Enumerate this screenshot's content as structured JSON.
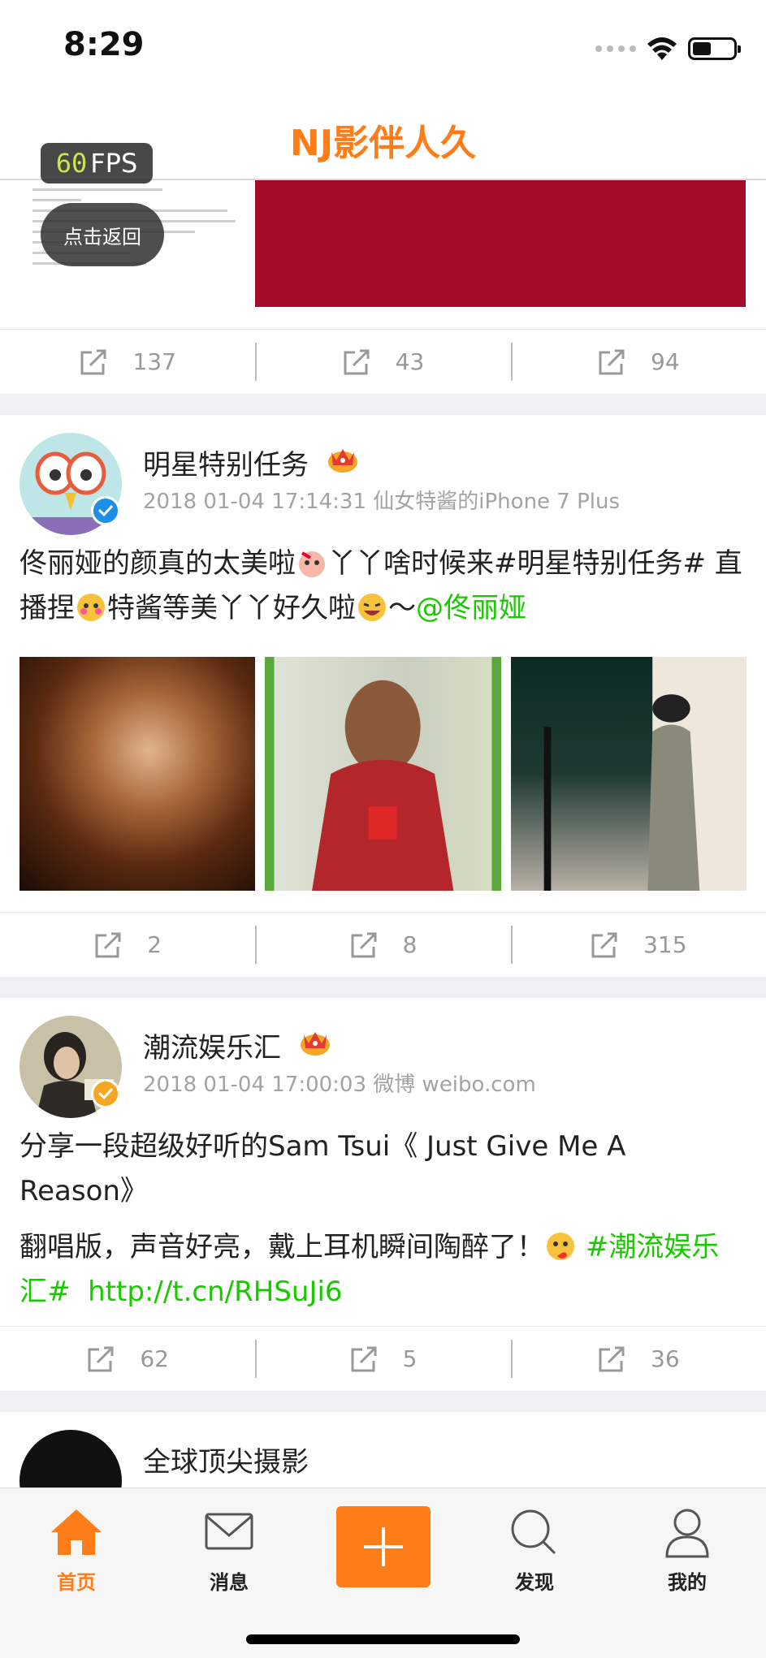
{
  "status_bar": {
    "time": "8:29",
    "battery_level": 0.45
  },
  "nav": {
    "title": "NJ影伴人久"
  },
  "overlay": {
    "fps_value": "60",
    "fps_unit": "FPS",
    "back_label": "点击返回"
  },
  "colors": {
    "brand": "#ff7d18",
    "link": "#19c900",
    "verified_blue": "#1d8fe8",
    "verified_gold": "#f5a623",
    "inactive_icon": "#555555"
  },
  "top_post": {
    "actions": [
      {
        "icon": "share-icon",
        "count": "137"
      },
      {
        "icon": "share-icon",
        "count": "43"
      },
      {
        "icon": "share-icon",
        "count": "94"
      }
    ]
  },
  "posts": [
    {
      "username": "明星特别任务",
      "badge": "crown-icon",
      "verified": "blue",
      "meta": "2018 01-04 17:14:31 仙女特酱的iPhone 7 Plus",
      "text_parts": [
        "佟丽娅的颜真的太美啦",
        "丫丫啥时候来#明星特别任务# 直播捏",
        "特酱等美丫丫好久啦",
        "～",
        "@佟丽娅"
      ],
      "actions": [
        {
          "icon": "share-icon",
          "count": "2"
        },
        {
          "icon": "share-icon",
          "count": "8"
        },
        {
          "icon": "share-icon",
          "count": "315"
        }
      ]
    },
    {
      "username": "潮流娱乐汇",
      "badge": "crown-icon",
      "verified": "gold",
      "meta": "2018 01-04 17:00:03 微博 weibo.com",
      "text_parts": [
        "分享一段超级好听的Sam Tsui《 Just Give Me A Reason》",
        "翻唱版，声音好亮，戴上耳机瞬间陶醉了！",
        "#潮流娱乐汇#",
        "http://t.cn/RHSuJi6"
      ],
      "actions": [
        {
          "icon": "share-icon",
          "count": "62"
        },
        {
          "icon": "share-icon",
          "count": "5"
        },
        {
          "icon": "share-icon",
          "count": "36"
        }
      ]
    },
    {
      "username": "全球顶尖摄影"
    }
  ],
  "tab_bar": {
    "tabs": [
      {
        "label": "首页",
        "icon": "home-icon",
        "active": true
      },
      {
        "label": "消息",
        "icon": "mail-icon",
        "active": false
      },
      {
        "label": "",
        "icon": "plus-icon",
        "active": false
      },
      {
        "label": "发现",
        "icon": "search-icon",
        "active": false
      },
      {
        "label": "我的",
        "icon": "person-icon",
        "active": false
      }
    ]
  }
}
